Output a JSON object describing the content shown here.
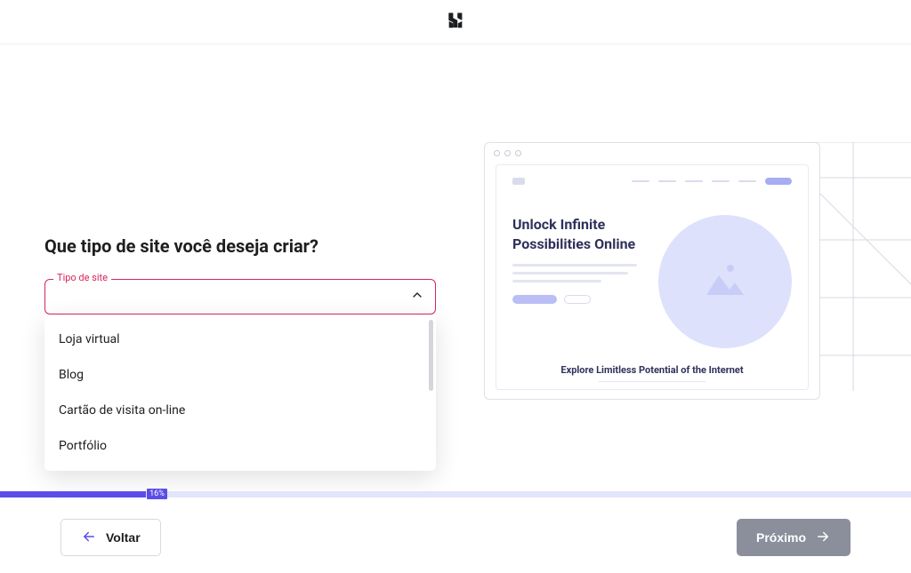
{
  "header": {
    "logo_name": "hostinger-logo"
  },
  "form": {
    "question": "Que tipo de site você deseja criar?",
    "field_label": "Tipo de site",
    "field_value": "",
    "options": [
      "Loja virtual",
      "Blog",
      "Cartão de visita on-line",
      "Portfólio"
    ]
  },
  "preview": {
    "headline": "Unlock Infinite Possibilities Online",
    "subtitle": "Explore Limitless Potential of the Internet"
  },
  "progress": {
    "percent": 16,
    "percent_label": "16%"
  },
  "footer": {
    "back_label": "Voltar",
    "next_label": "Próximo"
  },
  "colors": {
    "accent": "#5b4ee8",
    "error_border": "#d6265a",
    "progress_bg": "#e2e5fb",
    "next_disabled": "#8b8f9c"
  }
}
